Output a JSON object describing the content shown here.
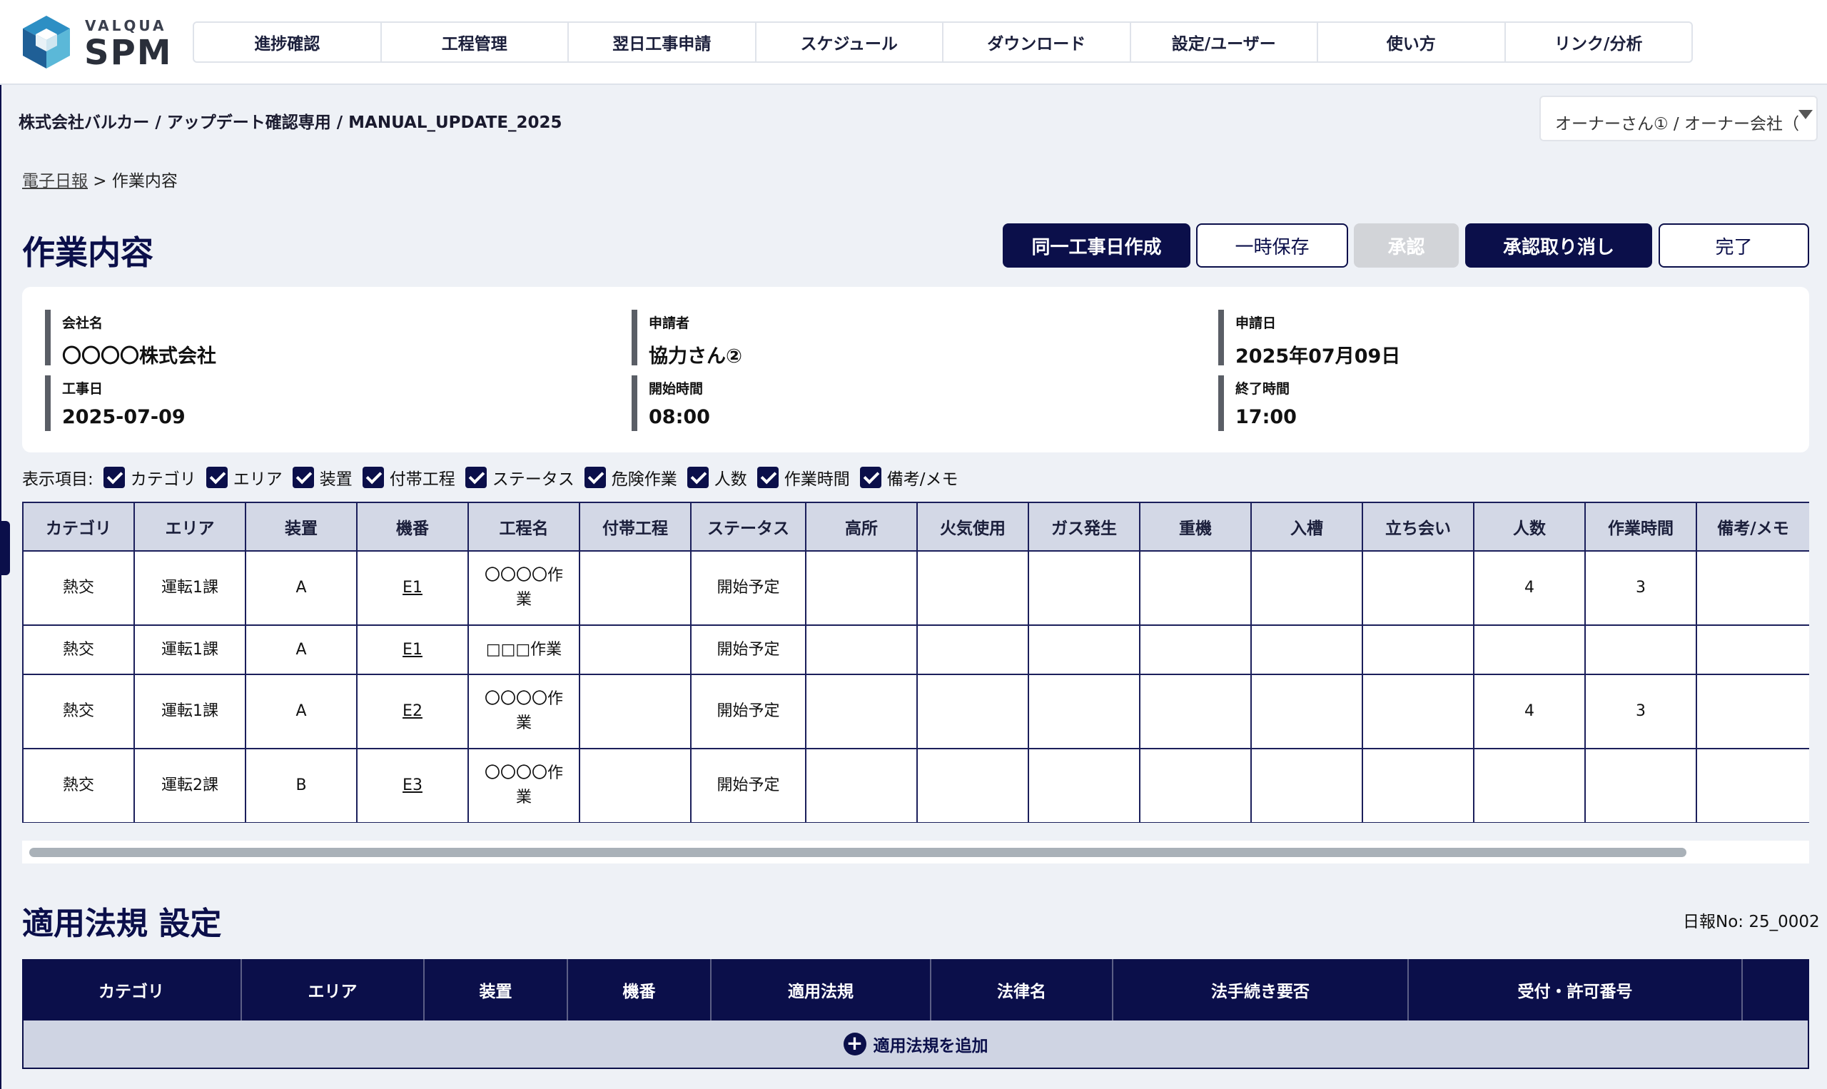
{
  "brand": {
    "small": "VALQUA",
    "big": "SPM"
  },
  "nav": [
    "進捗確認",
    "工程管理",
    "翌日工事申請",
    "スケジュール",
    "ダウンロード",
    "設定/ユーザー",
    "使い方",
    "リンク/分析"
  ],
  "project_path": "株式会社バルカー / アップデート確認専用 / MANUAL_UPDATE_2025",
  "owner_select": "オーナーさん① / オーナー会社（",
  "breadcrumb": {
    "link": "電子日報",
    "sep": " > ",
    "current": "作業内容"
  },
  "page_title": "作業内容",
  "buttons": {
    "same_day": "同一工事日作成",
    "temp_save": "一時保存",
    "approve": "承認",
    "cancel_approve": "承認取り消し",
    "complete": "完了"
  },
  "info": {
    "company_label": "会社名",
    "company": "〇〇〇〇株式会社",
    "applicant_label": "申請者",
    "applicant": "協力さん②",
    "apply_date_label": "申請日",
    "apply_date": "2025年07月09日",
    "work_date_label": "工事日",
    "work_date": "2025-07-09",
    "start_label": "開始時間",
    "start": "08:00",
    "end_label": "終了時間",
    "end": "17:00"
  },
  "display_items": {
    "label": "表示項目:",
    "items": [
      "カテゴリ",
      "エリア",
      "装置",
      "付帯工程",
      "ステータス",
      "危険作業",
      "人数",
      "作業時間",
      "備考/メモ"
    ]
  },
  "work_table": {
    "headers": [
      "カテゴリ",
      "エリア",
      "装置",
      "機番",
      "工程名",
      "付帯工程",
      "ステータス",
      "高所",
      "火気使用",
      "ガス発生",
      "重機",
      "入槽",
      "立ち会い",
      "人数",
      "作業時間",
      "備考/メモ"
    ],
    "rows": [
      {
        "cat": "熱交",
        "area": "運転1課",
        "dev": "A",
        "no": "E1",
        "proc1": "〇〇〇〇作",
        "proc2": "業",
        "status": "開始予定",
        "people": "4",
        "hours": "3"
      },
      {
        "cat": "熱交",
        "area": "運転1課",
        "dev": "A",
        "no": "E1",
        "proc1": "□□□作業",
        "proc2": "",
        "status": "開始予定",
        "people": "",
        "hours": ""
      },
      {
        "cat": "熱交",
        "area": "運転1課",
        "dev": "A",
        "no": "E2",
        "proc1": "〇〇〇〇作",
        "proc2": "業",
        "status": "開始予定",
        "people": "4",
        "hours": "3"
      },
      {
        "cat": "熱交",
        "area": "運転2課",
        "dev": "B",
        "no": "E3",
        "proc1": "〇〇〇〇作",
        "proc2": "業",
        "status": "開始予定",
        "people": "",
        "hours": ""
      }
    ]
  },
  "law_section": {
    "title": "適用法規 設定",
    "report_no": "日報No: 25_0002",
    "headers": [
      "カテゴリ",
      "エリア",
      "装置",
      "機番",
      "適用法規",
      "法律名",
      "法手続き要否",
      "受付・許可番号"
    ],
    "add_label": "適用法規を追加"
  }
}
